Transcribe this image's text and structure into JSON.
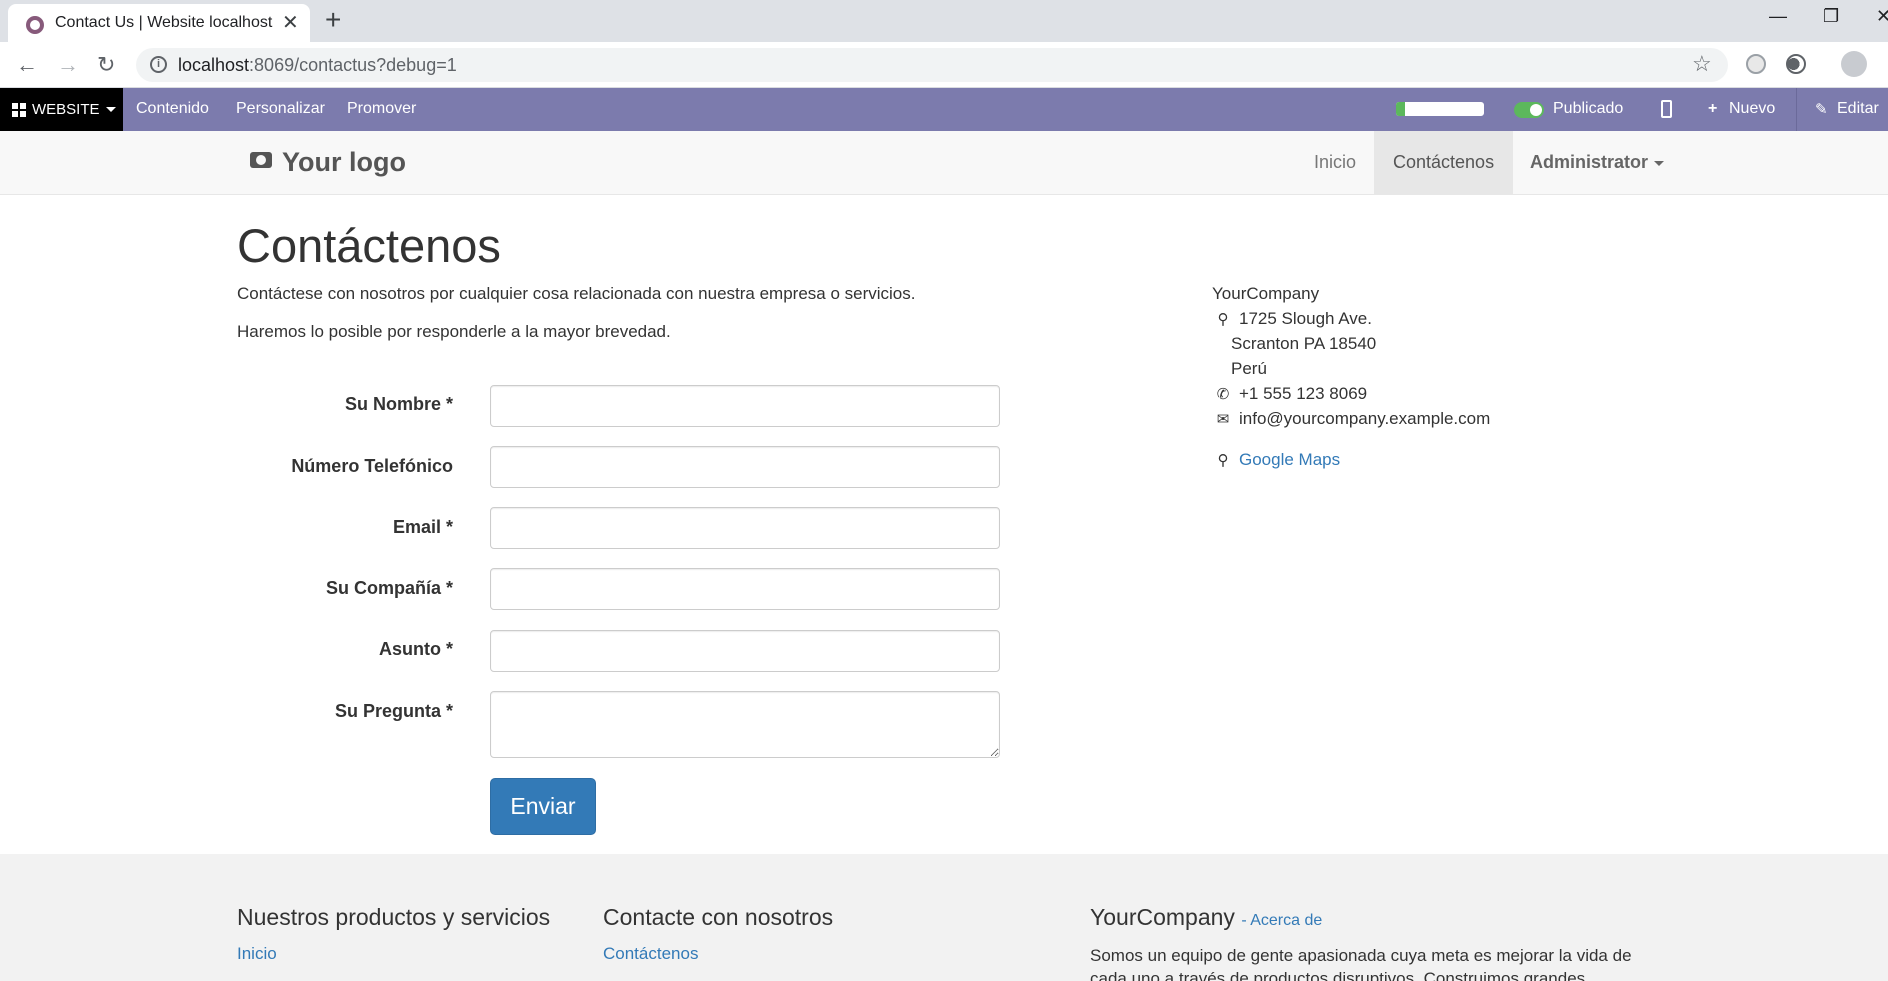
{
  "browser": {
    "tab_title": "Contact Us | Website localhost",
    "url_host": "localhost",
    "url_path": ":8069/contactus?debug=1",
    "window_controls": [
      "—",
      "❐",
      "✕"
    ]
  },
  "editbar": {
    "website_label": "WEBSITE",
    "menu": [
      "Contenido",
      "Personalizar",
      "Promover"
    ],
    "seo_score": 0.1,
    "published_label": "Publicado",
    "new_label": "Nuevo",
    "edit_label": "Editar",
    "colors": {
      "bar": "#7c7bad",
      "toggle_on": "#5cb85c"
    }
  },
  "header": {
    "logo_text": "Your logo",
    "nav": [
      "Inicio",
      "Contáctenos",
      "Administrator"
    ],
    "active_nav": "Contáctenos"
  },
  "main": {
    "title": "Contáctenos",
    "lead_1": "Contáctese con nosotros por cualquier cosa relacionada con nuestra empresa o servicios.",
    "lead_2": "Haremos lo posible por responderle a la mayor brevedad.",
    "form": {
      "labels": [
        "Su Nombre *",
        "Número Telefónico",
        "Email *",
        "Su Compañía *",
        "Asunto *",
        "Su Pregunta *"
      ],
      "values": [
        "",
        "",
        "",
        "",
        "",
        ""
      ],
      "submit": "Enviar"
    },
    "address": {
      "company": "YourCompany",
      "street": "1725 Slough Ave.",
      "city": "Scranton PA 18540",
      "country": "Perú",
      "phone": "+1 555 123 8069",
      "email": "info@yourcompany.example.com",
      "map_link": "Google Maps"
    }
  },
  "footer": {
    "col1_title": "Nuestros productos y servicios",
    "col1_link": "Inicio",
    "col2_title": "Contacte con nosotros",
    "col2_link": "Contáctenos",
    "col3_title": "YourCompany",
    "col3_about": "- Acerca de",
    "col3_text": "Somos un equipo de gente apasionada cuya meta es mejorar la vida de cada uno a través de productos disruptivos. Construimos grandes"
  },
  "icons": {
    "favicon": "odoo-icon",
    "location": "map-marker-icon",
    "phone": "phone-icon",
    "email": "envelope-icon"
  }
}
